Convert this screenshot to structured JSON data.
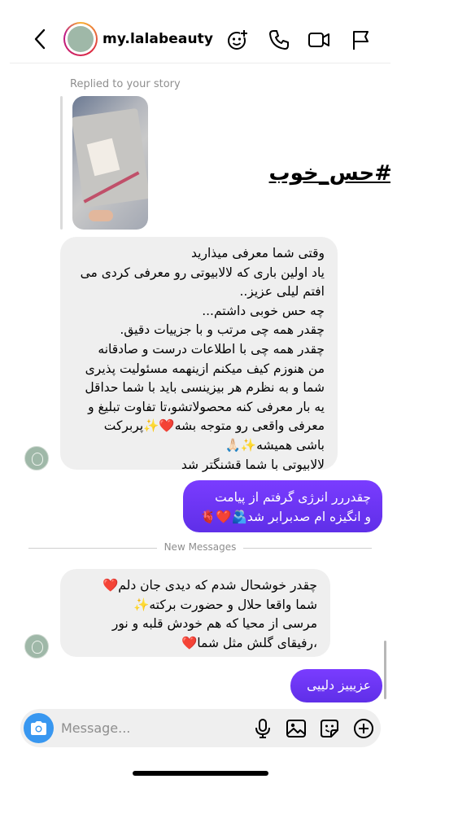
{
  "header": {
    "username": "my.lalabeauty",
    "icons": [
      "back-icon",
      "add-sticker-icon",
      "phone-icon",
      "video-icon",
      "flag-icon"
    ]
  },
  "story_reply": {
    "caption": "Replied to your story",
    "story_text": "#حس_خوب"
  },
  "messages": [
    {
      "from": "them",
      "text": "وقتی شما معرفی میذارید\nیاد اولین باری که لالابیوتی رو معرفی کردی می افتم لیلی عزیز..\nچه حس خوبی داشتم...\nچقدر همه چی مرتب و با جزییات دقیق.\nچقدر همه چی با اطلاعات درست و صادقانه\nمن هنوزم کیف میکنم ازینهمه مسئولیت پذیری شما و به نظرم هر بیزینسی باید با شما حداقل یه بار معرفی کنه محصولاتشو،تا تفاوت تبلیغ و معرفی واقعی رو متوجه بشه❤️✨پربرکت باشی همیشه✨🙏🏻\nلالابیوتی با شما قشنگتر شد"
    },
    {
      "from": "me",
      "text": "چقدررر انرژی گرفتم از پیامت\nو انگیزه ام صدبرابر شد🫂❤️🫀"
    },
    {
      "from": "them",
      "text": "چقدر خوشحال شدم که دیدی جان دلم❤️\nشما واقعا حلال و حضورت برکته✨\nمرسی از محیا که هم خودش قلبه و نور ،رفیقای گلش مثل شما❤️"
    },
    {
      "from": "me",
      "text": "عزیییز دلییی"
    }
  ],
  "divider": {
    "label": "New Messages"
  },
  "composer": {
    "placeholder": "Message...",
    "icons": [
      "camera-icon",
      "microphone-icon",
      "gallery-icon",
      "sticker-icon",
      "plus-icon"
    ]
  },
  "colors": {
    "outgoing_bubble": "#6b35f5",
    "incoming_bubble": "#efefef",
    "camera_button": "#3897f0",
    "muted_text": "#8e8e8e"
  }
}
